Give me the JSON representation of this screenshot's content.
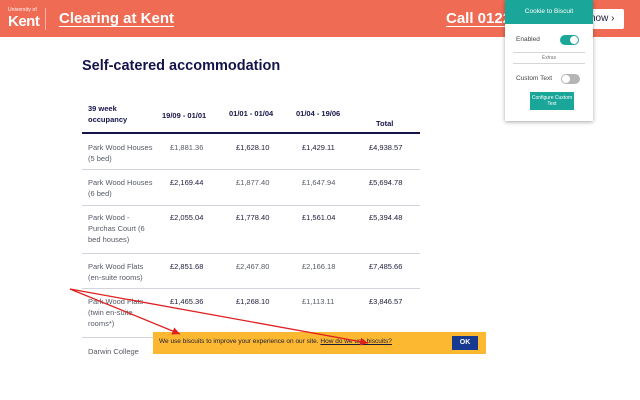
{
  "header": {
    "logo_small": "University of",
    "logo_big": "Kent",
    "site_title": "Clearing at Kent",
    "call_text": "Call 01227",
    "call_button": "now ›",
    "colors": {
      "header_bg": "#ef6b54",
      "title_color": "#15144a"
    }
  },
  "main": {
    "title": "Self-catered accommodation",
    "table": {
      "headers": [
        "39 week occupancy",
        "19/09 - 01/01",
        "01/01 - 01/04",
        "01/04 - 19/06",
        "Total"
      ],
      "rows": [
        {
          "name": "Park Wood Houses (5 bed)",
          "c1": "£1,881.36",
          "c2": "£1,628.10",
          "c3": "£1,429.11",
          "total": "£4,938.57"
        },
        {
          "name": "Park Wood Houses (6 bed)",
          "c1": "£2,169.44",
          "c2": "£1,877.40",
          "c3": "£1,647.94",
          "total": "£5,694.78"
        },
        {
          "name": "Park Wood - Purchas Court (6 bed houses)",
          "c1": "£2,055.04",
          "c2": "£1,778.40",
          "c3": "£1,561.04",
          "total": "£5,394.48"
        },
        {
          "name": "Park Wood Flats (en-suite rooms)",
          "c1": "£2,851.68",
          "c2": "£2,467.80",
          "c3": "£2,166.18",
          "total": "£7,485.66"
        },
        {
          "name": "Park Wood Flats (twin en-suite rooms*)",
          "c1": "£1,465.36",
          "c2": "£1,268.10",
          "c3": "£1,113.11",
          "total": "£3,846.57"
        },
        {
          "name": "Darwin College",
          "c1": "",
          "c2": "",
          "c3": "",
          "total": ""
        }
      ]
    }
  },
  "extension": {
    "title": "Cookie to Biscuit",
    "enabled_label": "Enabled",
    "extras_label": "Extras",
    "custom_text_label": "Custom Text",
    "configure_button": "Configure Custom Text",
    "colors": {
      "accent": "#1aa698",
      "toggle_off": "#b5b5b5"
    }
  },
  "cookie_banner": {
    "text": "We use biscuits to improve your experience on our site.",
    "link": "How do we use biscuits?",
    "ok_button": "OK",
    "colors": {
      "bg": "#fcb830",
      "ok_bg": "#17398f"
    }
  },
  "annotations": {
    "arrow_color": "#e02020"
  }
}
